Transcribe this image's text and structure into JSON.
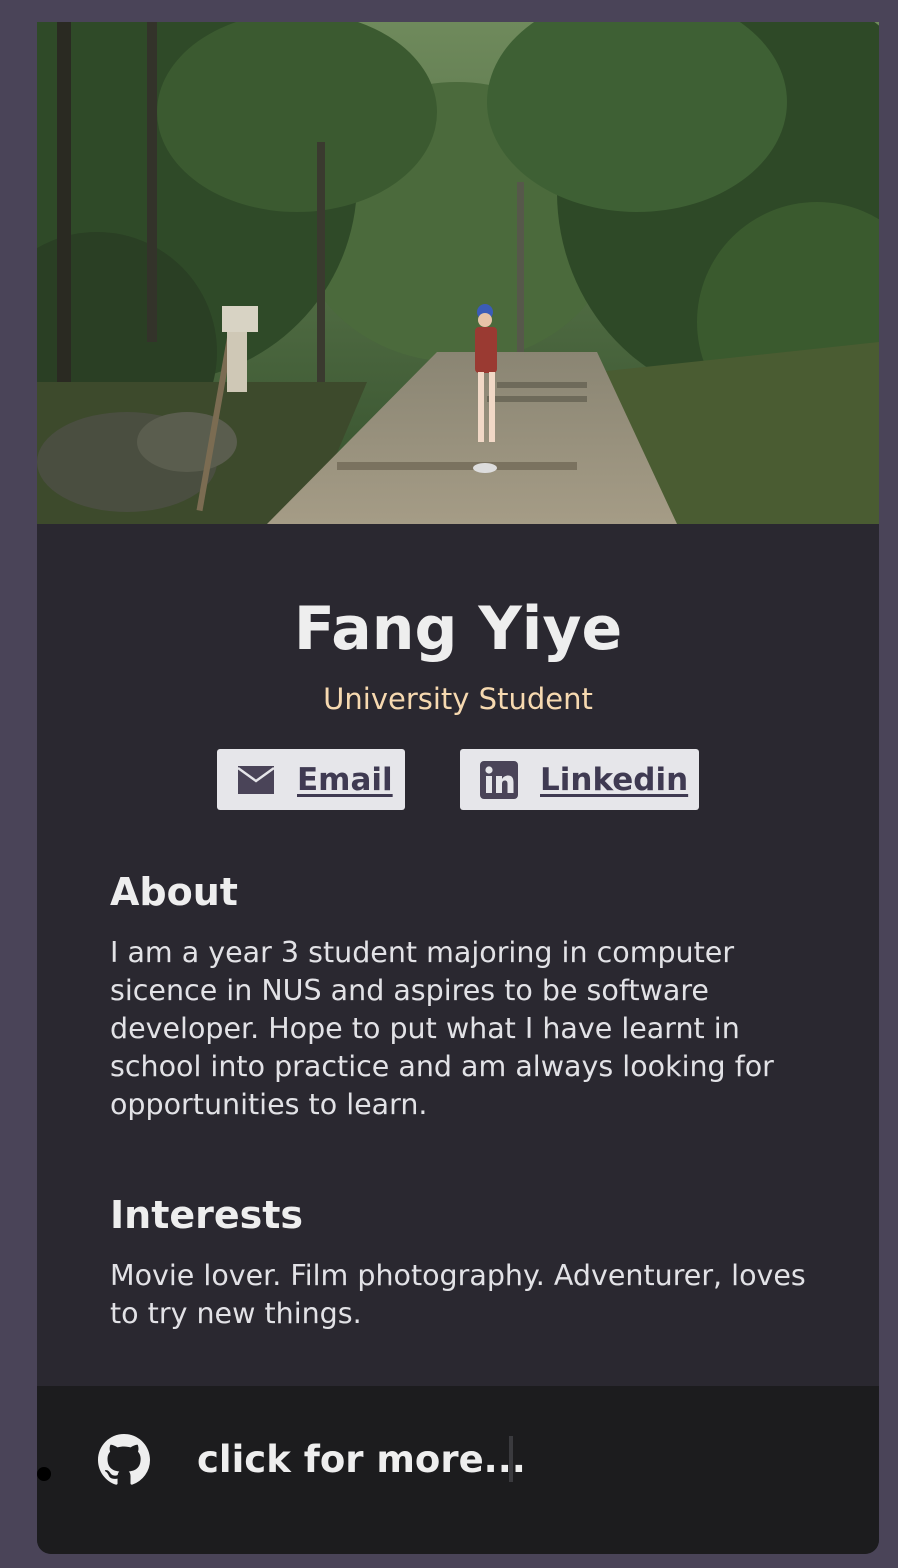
{
  "profile": {
    "name": "Fang Yiye",
    "title": "University Student"
  },
  "links": {
    "email_label": "Email",
    "linkedin_label": "Linkedin"
  },
  "about": {
    "heading": "About",
    "text": "I am a year 3 student majoring in computer sicence in NUS and aspires to be software developer. Hope to put what I have learnt in school into practice and am always looking for opportunities to learn."
  },
  "interests": {
    "heading": "Interests",
    "text": "Movie lover. Film photography. Adventurer, loves to try new things."
  },
  "footer": {
    "more_label": "click for more..."
  },
  "colors": {
    "page_bg": "#4a4458",
    "card_bg": "#2a2830",
    "footer_bg": "#1c1c1e",
    "accent_title": "#f6d9b0",
    "button_bg": "#e6e6ea",
    "button_text": "#3f3a52"
  },
  "icons": {
    "email": "envelope-icon",
    "linkedin": "linkedin-icon",
    "github": "github-icon"
  }
}
